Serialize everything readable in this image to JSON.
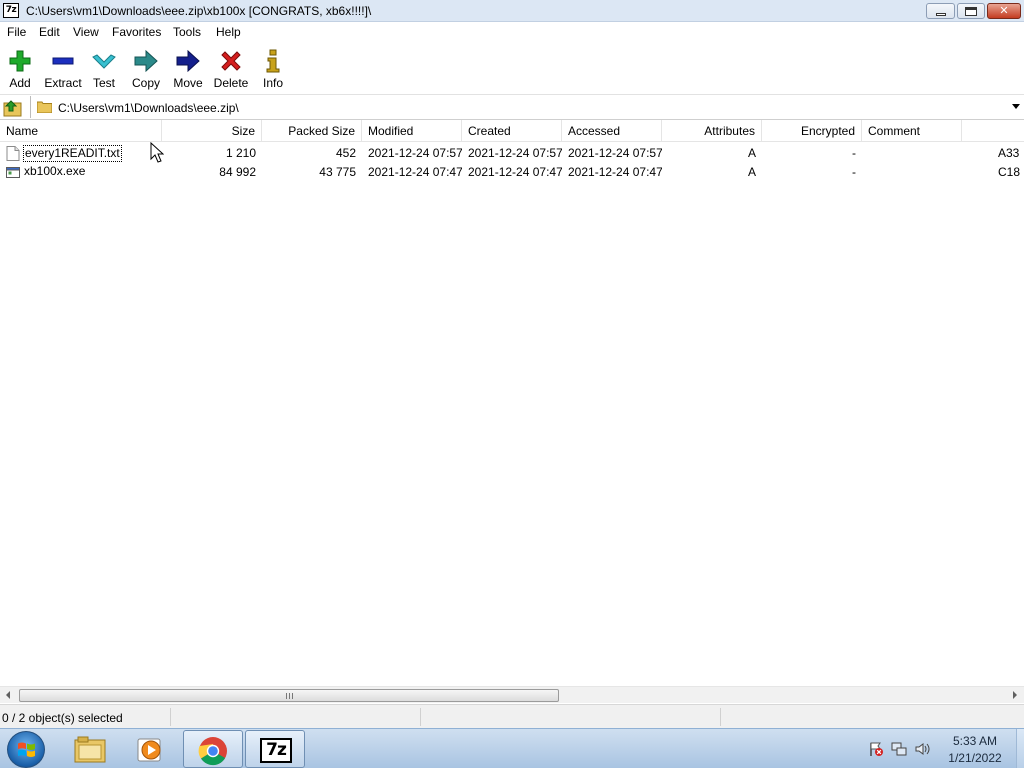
{
  "window": {
    "app_icon_text": "7z",
    "title": "C:\\Users\\vm1\\Downloads\\eee.zip\\xb100x [CONGRATS, xb6x!!!!]\\"
  },
  "menu": [
    "File",
    "Edit",
    "View",
    "Favorites",
    "Tools",
    "Help"
  ],
  "toolbar": {
    "add": "Add",
    "extract": "Extract",
    "test": "Test",
    "copy": "Copy",
    "move": "Move",
    "delete": "Delete",
    "info": "Info"
  },
  "address": {
    "path": "C:\\Users\\vm1\\Downloads\\eee.zip\\"
  },
  "columns": {
    "name": "Name",
    "size": "Size",
    "packed": "Packed Size",
    "modified": "Modified",
    "created": "Created",
    "accessed": "Accessed",
    "attributes": "Attributes",
    "encrypted": "Encrypted",
    "comment": "Comment"
  },
  "files": [
    {
      "name": "every1READIT.txt",
      "icon": "text-file-icon",
      "size": "1 210",
      "packed": "452",
      "modified": "2021-12-24 07:57",
      "created": "2021-12-24 07:57",
      "accessed": "2021-12-24 07:57",
      "attributes": "A",
      "encrypted": "-",
      "comment": "",
      "crc": "A33"
    },
    {
      "name": "xb100x.exe",
      "icon": "exe-file-icon",
      "size": "84 992",
      "packed": "43 775",
      "modified": "2021-12-24 07:47",
      "created": "2021-12-24 07:47",
      "accessed": "2021-12-24 07:47",
      "attributes": "A",
      "encrypted": "-",
      "comment": "",
      "crc": "C18"
    }
  ],
  "status": {
    "selection": "0 / 2 object(s) selected"
  },
  "taskbar": {
    "pinned": [
      "start-orb",
      "explorer-icon",
      "media-player-icon",
      "chrome-icon",
      "7zip-icon"
    ],
    "active": "7zip-icon",
    "taskbar_7z_text": "7z",
    "clock_time": "5:33 AM",
    "clock_date": "1/21/2022"
  },
  "colors": {
    "add": "#1faa2b",
    "extract": "#1c2fbf",
    "test": "#2ba6b8",
    "copy": "#2b8a8a",
    "move": "#141f8c",
    "delete": "#d51e1e",
    "info": "#c8a21a"
  }
}
